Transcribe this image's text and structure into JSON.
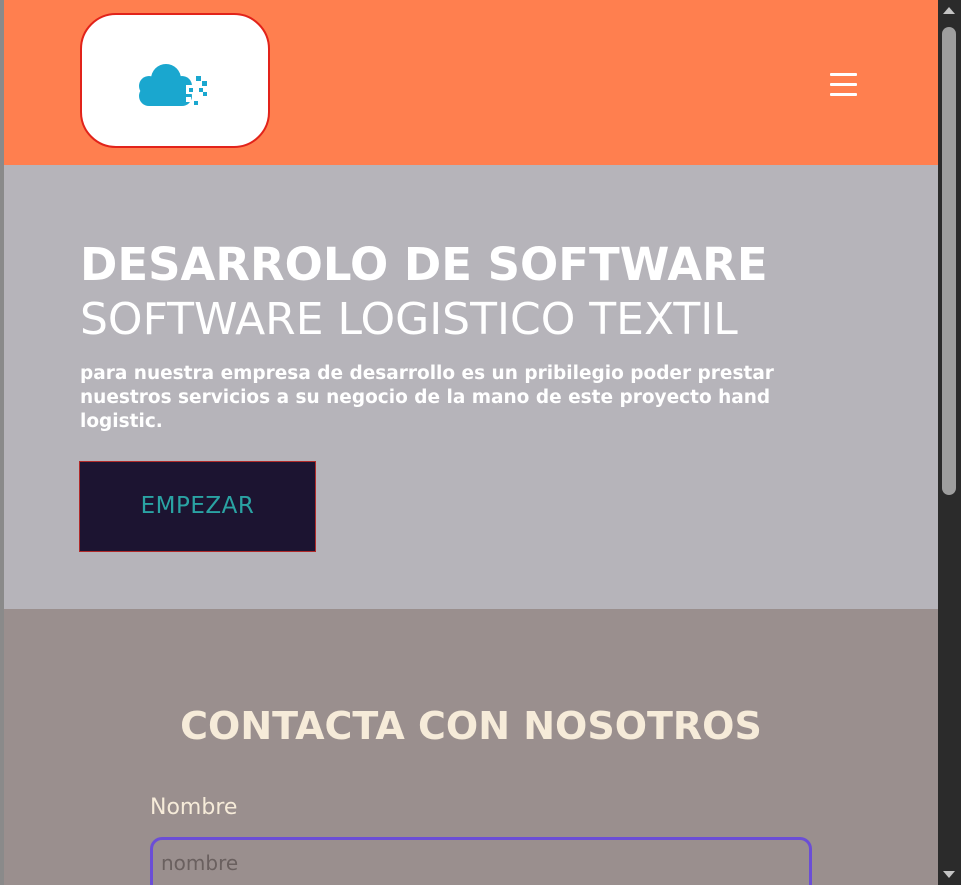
{
  "header": {
    "logo_icon": "cloud-logo-icon",
    "menu_icon": "hamburger-menu-icon",
    "background_color": "#ff7f4f"
  },
  "hero": {
    "title": "DESARROLO DE SOFTWARE",
    "subtitle": "SOFTWARE LOGISTICO TEXTIL",
    "description": "para nuestra empresa de desarrollo es un pribilegio poder prestar nuestros servicios a su negocio de la mano de este proyecto hand logistic.",
    "button_label": "EMPEZAR",
    "background_color": "#b6b4ba"
  },
  "contact": {
    "title": "CONTACTA CON NOSOTROS",
    "name_label": "Nombre",
    "name_placeholder": "nombre",
    "name_value": "",
    "background_color": "#9a8f8e"
  },
  "colors": {
    "accent_button": "#1c1431",
    "button_text": "#2aa3a3",
    "input_border": "#6b4ed6",
    "logo_border": "#e2231a",
    "logo_cloud": "#1aa7cf"
  }
}
